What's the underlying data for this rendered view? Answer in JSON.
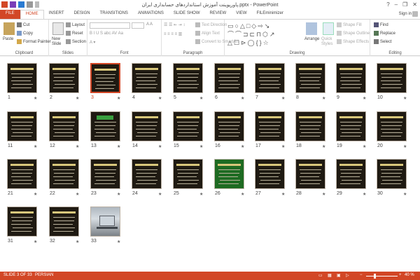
{
  "window": {
    "title": "پاورپوینت آموزش استانداردهای حسابداری ایران.pptx - PowerPoint",
    "help": "?",
    "minimize": "–",
    "restore": "❐",
    "close": "✕",
    "sign_in": "Sign in"
  },
  "tabs": [
    "FILE",
    "HOME",
    "INSERT",
    "DESIGN",
    "TRANSITIONS",
    "ANIMATIONS",
    "SLIDE SHOW",
    "REVIEW",
    "VIEW",
    "FILEminimizer"
  ],
  "ribbon": {
    "clipboard": {
      "label": "Clipboard",
      "paste": "Paste",
      "cut": "Cut",
      "copy": "Copy",
      "format_painter": "Format Painter"
    },
    "slides": {
      "label": "Slides",
      "new_slide": "New Slide",
      "layout": "Layout",
      "reset": "Reset",
      "section": "Section"
    },
    "font": {
      "label": "Font"
    },
    "paragraph": {
      "label": "Paragraph",
      "text_direction": "Text Direction",
      "align_text": "Align Text",
      "convert_smartart": "Convert to SmartArt"
    },
    "drawing": {
      "label": "Drawing",
      "arrange": "Arrange",
      "quick_styles": "Quick Styles",
      "shape_fill": "Shape Fill",
      "shape_outline": "Shape Outline",
      "shape_effects": "Shape Effects"
    },
    "editing": {
      "label": "Editing",
      "find": "Find",
      "replace": "Replace",
      "select": "Select"
    }
  },
  "slides": [
    {
      "n": "1",
      "kind": "dark"
    },
    {
      "n": "2",
      "kind": "dark"
    },
    {
      "n": "3",
      "kind": "dark",
      "selected": true
    },
    {
      "n": "4",
      "kind": "dark"
    },
    {
      "n": "5",
      "kind": "dark"
    },
    {
      "n": "6",
      "kind": "dark"
    },
    {
      "n": "7",
      "kind": "dark"
    },
    {
      "n": "8",
      "kind": "dark"
    },
    {
      "n": "9",
      "kind": "dark"
    },
    {
      "n": "10",
      "kind": "dark"
    },
    {
      "n": "11",
      "kind": "dark"
    },
    {
      "n": "12",
      "kind": "dark"
    },
    {
      "n": "13",
      "kind": "greenbox"
    },
    {
      "n": "14",
      "kind": "dark"
    },
    {
      "n": "15",
      "kind": "dark"
    },
    {
      "n": "16",
      "kind": "dark"
    },
    {
      "n": "17",
      "kind": "dark"
    },
    {
      "n": "18",
      "kind": "dark"
    },
    {
      "n": "19",
      "kind": "dark"
    },
    {
      "n": "20",
      "kind": "dark"
    },
    {
      "n": "21",
      "kind": "dark"
    },
    {
      "n": "22",
      "kind": "dark"
    },
    {
      "n": "23",
      "kind": "dark"
    },
    {
      "n": "24",
      "kind": "dark"
    },
    {
      "n": "25",
      "kind": "dark"
    },
    {
      "n": "26",
      "kind": "green"
    },
    {
      "n": "27",
      "kind": "dark"
    },
    {
      "n": "28",
      "kind": "dark"
    },
    {
      "n": "29",
      "kind": "dark"
    },
    {
      "n": "30",
      "kind": "dark"
    },
    {
      "n": "31",
      "kind": "dark"
    },
    {
      "n": "32",
      "kind": "dark"
    },
    {
      "n": "33",
      "kind": "photo"
    }
  ],
  "star_glyph": "★",
  "status": {
    "slide": "SLIDE 3 OF 33",
    "language": "PERSIAN",
    "zoom": "40 %",
    "zoom_minus": "−",
    "zoom_plus": "+",
    "zoom_level": 0.4
  },
  "colors": {
    "accent": "#d24726",
    "slide_bg": "#1f1a12",
    "slide_green": "#1e6b22"
  }
}
